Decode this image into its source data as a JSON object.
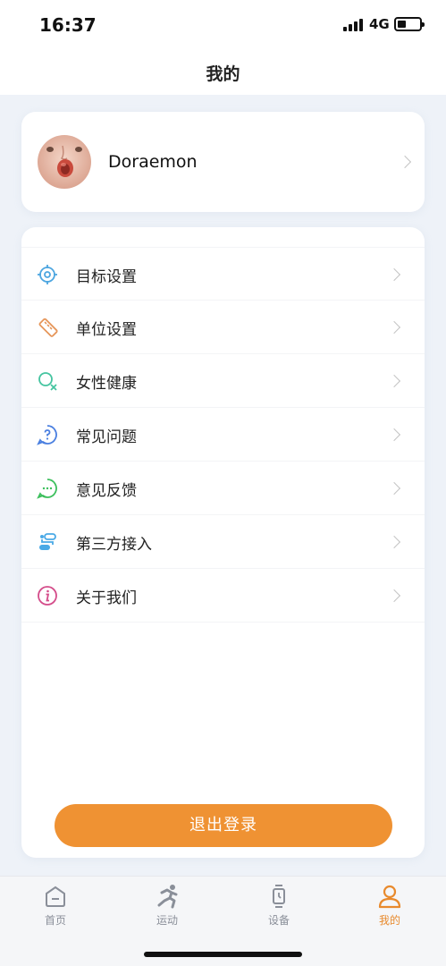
{
  "status_bar": {
    "time": "16:37",
    "network": "4G"
  },
  "header": {
    "title": "我的"
  },
  "profile": {
    "username": "Doraemon"
  },
  "menu": {
    "items": [
      {
        "label": "目标设置",
        "icon": "target-icon",
        "color": "#4da6e0"
      },
      {
        "label": "单位设置",
        "icon": "ruler-icon",
        "color": "#e6965a"
      },
      {
        "label": "女性健康",
        "icon": "female-health-icon",
        "color": "#45c4a0"
      },
      {
        "label": "常见问题",
        "icon": "question-icon",
        "color": "#4a7fe0"
      },
      {
        "label": "意见反馈",
        "icon": "feedback-icon",
        "color": "#3cbf5c"
      },
      {
        "label": "第三方接入",
        "icon": "third-party-icon",
        "color": "#49a9e6"
      },
      {
        "label": "关于我们",
        "icon": "info-icon",
        "color": "#d44c8a"
      }
    ]
  },
  "logout": {
    "label": "退出登录",
    "color": "#ef9233"
  },
  "tabs": [
    {
      "label": "首页",
      "icon": "home-icon"
    },
    {
      "label": "运动",
      "icon": "running-icon"
    },
    {
      "label": "设备",
      "icon": "watch-icon"
    },
    {
      "label": "我的",
      "icon": "profile-icon",
      "active": true
    }
  ],
  "colors": {
    "accent": "#e88a2d",
    "background": "#eef2f8"
  }
}
